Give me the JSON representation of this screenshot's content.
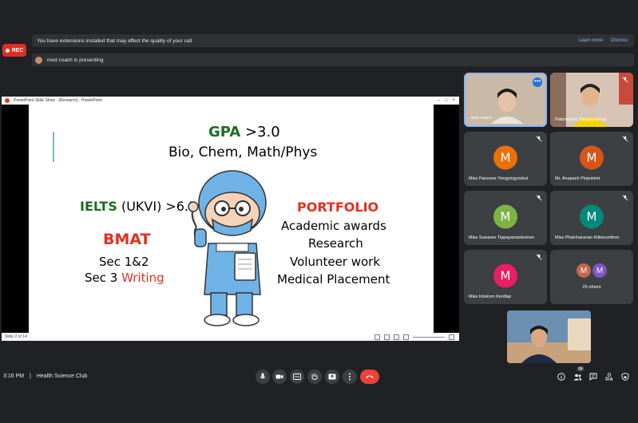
{
  "banner": {
    "rec_label": "REC",
    "extensions_message": "You have extensions installed that may affect the quality of your call",
    "learn_more": "Learn more",
    "dismiss": "Dismiss",
    "presenting_message": "med coach is presenting"
  },
  "ppt": {
    "window_title": "PowerPoint Slide Show - [Research] - PowerPoint",
    "status": "Slide 2 of 14",
    "slide": {
      "gpa_label": "GPA",
      "gpa_value": " >3.0",
      "gpa_subjects": "Bio, Chem, Math/Phys",
      "ielts_label": "IELTS",
      "ielts_value": " (UKVI) >6.5",
      "bmat_label": "BMAT",
      "bmat_sec1": "Sec 1&2",
      "bmat_sec3_prefix": "Sec 3 ",
      "bmat_sec3_highlight": "Writing",
      "portfolio_label": "PORTFOLIO",
      "portfolio_items": [
        "Academic awards",
        "Research",
        "Volunteer work",
        "Medical Placement"
      ]
    }
  },
  "participants": [
    {
      "name": "med coach",
      "initial": ""
    },
    {
      "name": "Patompong Satapornpong",
      "initial": ""
    },
    {
      "name": "Miss Panunee Yongyingyoskul",
      "initial": "M",
      "color": "#e8710a"
    },
    {
      "name": "Mr. Anapach Pinpokintr",
      "initial": "M",
      "color": "#d9541a"
    },
    {
      "name": "Miss Suwaree Tippayamaskomon",
      "initial": "M",
      "color": "#7cb342"
    },
    {
      "name": "Miss Phatcharanan Kittisoonthon",
      "initial": "M",
      "color": "#00897b"
    },
    {
      "name": "Miss Intukorn Kerdlap",
      "initial": "M",
      "color": "#e91e63"
    }
  ],
  "others": {
    "label": "25 others",
    "initial_a": "M",
    "initial_b": "M",
    "color_a": "#c0674e",
    "color_b": "#7e57c2"
  },
  "meeting": {
    "time": "3:16 PM",
    "separator": "|",
    "name": "Health Science Club",
    "participant_count": "34"
  },
  "colors": {
    "accent": "#8ab4f8",
    "end_call": "#ea4335",
    "rec": "#d93025"
  }
}
